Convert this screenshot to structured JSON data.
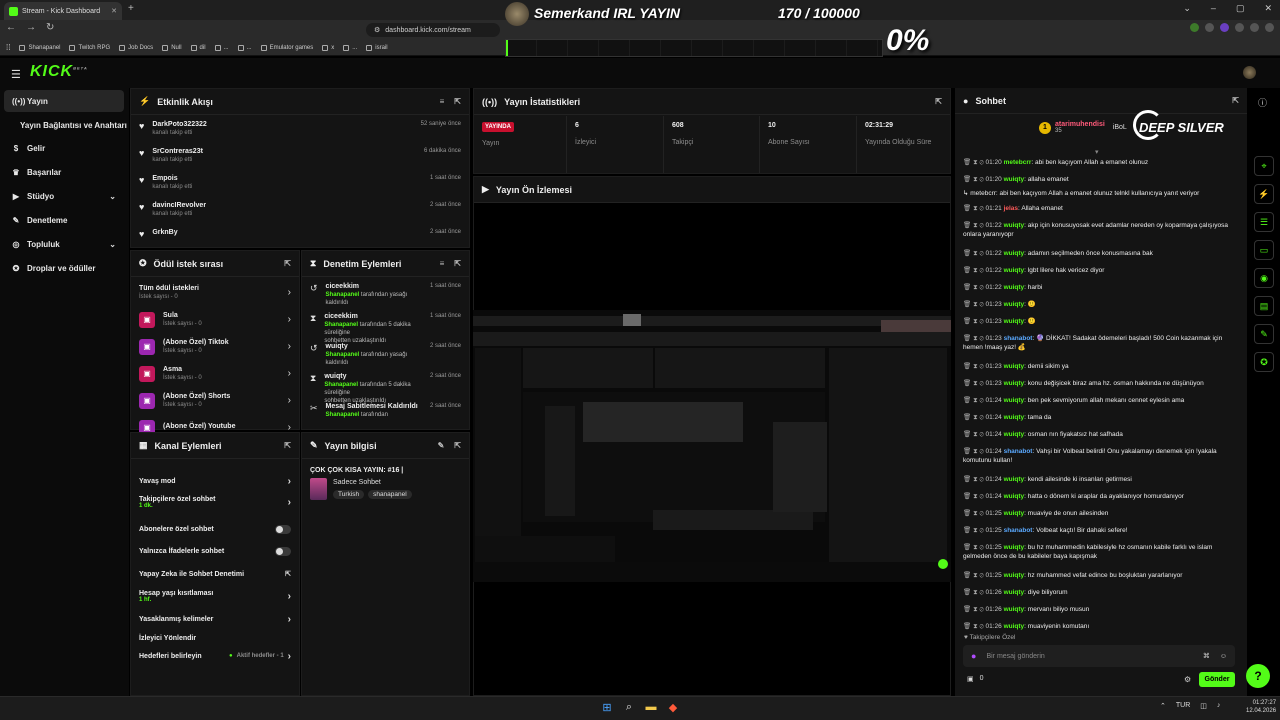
{
  "browser": {
    "tab_title": "Stream - Kick Dashboard",
    "url": "dashboard.kick.com/stream",
    "bookmarks": [
      "Shanapanel",
      "Twitch RPG",
      "Job Docs",
      "Null",
      "dil",
      "...",
      "...",
      "Emulator games",
      "x",
      "...",
      "israil"
    ]
  },
  "overlay": {
    "title": "Semerkand IRL YAYIN",
    "counter": "170 / 100000",
    "percent": "0%",
    "progress": 0.0017
  },
  "sidebar": {
    "items": [
      {
        "label": "Yayın",
        "icon": "broadcast-icon",
        "active": true
      },
      {
        "label": "Yayın Bağlantısı ve Anahtarı",
        "icon": "",
        "active": false
      },
      {
        "label": "Gelir",
        "icon": "money-icon",
        "active": false
      },
      {
        "label": "Başarılar",
        "icon": "trophy-icon",
        "active": false
      },
      {
        "label": "Stüdyo",
        "icon": "video-icon",
        "active": false,
        "expandable": true
      },
      {
        "label": "Denetleme",
        "icon": "wrench-icon",
        "active": false
      },
      {
        "label": "Topluluk",
        "icon": "globe-icon",
        "active": false,
        "expandable": true
      },
      {
        "label": "Droplar ve ödüller",
        "icon": "gift-icon",
        "active": false
      }
    ]
  },
  "activity": {
    "title": "Etkinlik Akışı",
    "events": [
      {
        "name": "DarkPoto322322",
        "action": "kanalı takip etti",
        "time": "52 saniye önce"
      },
      {
        "name": "SrContreras23t",
        "action": "kanalı takip etti",
        "time": "6 dakika önce"
      },
      {
        "name": "Empois",
        "action": "kanalı takip etti",
        "time": "1 saat önce"
      },
      {
        "name": "davincIRevolver",
        "action": "kanalı takip etti",
        "time": "2 saat önce"
      },
      {
        "name": "GrknBy",
        "action": "",
        "time": "2 saat önce"
      }
    ]
  },
  "stats": {
    "title": "Yayın İstatistikleri",
    "live_label": "YAYINDA",
    "live_sub": "Yayın",
    "items": [
      {
        "value": "6",
        "label": "İzleyici"
      },
      {
        "value": "608",
        "label": "Takipçi"
      },
      {
        "value": "10",
        "label": "Abone Sayısı"
      },
      {
        "value": "02:31:29",
        "label": "Yayında Olduğu Süre"
      }
    ]
  },
  "preview": {
    "title": "Yayın Ön İzlemesi"
  },
  "rewards": {
    "title": "Ödül istek sırası",
    "all_label": "Tüm ödül istekleri",
    "all_sub": "İstek sayısı - 0",
    "items": [
      {
        "label": "Sula",
        "sub": "İstek sayısı - 0",
        "color": "#c2185b"
      },
      {
        "label": "(Abone Özel) Tiktok",
        "sub": "İstek sayısı - 0",
        "color": "#9c27b0"
      },
      {
        "label": "Asma",
        "sub": "İstek sayısı - 0",
        "color": "#c2185b"
      },
      {
        "label": "(Abone Özel) Shorts",
        "sub": "İstek sayısı - 0",
        "color": "#9c27b0"
      },
      {
        "label": "(Abone Özel) Youtube",
        "sub": "",
        "color": "#9c27b0"
      }
    ]
  },
  "mod_actions": {
    "title": "Denetim Eylemleri",
    "items": [
      {
        "name": "ciceekkim",
        "actor": "Shanapanel",
        "desc": "tarafından yasağı kaldırıldı",
        "desc2": "",
        "time": "1 saat önce",
        "icon": "undo-icon"
      },
      {
        "name": "ciceekkim",
        "actor": "Shanapanel",
        "desc": "tarafından 5 dakika süreliğine",
        "desc2": "sohbetten uzaklaştırıldı",
        "time": "1 saat önce",
        "icon": "hourglass-icon"
      },
      {
        "name": "wuiqty",
        "actor": "Shanapanel",
        "desc": "tarafından yasağı kaldırıldı",
        "desc2": "",
        "time": "2 saat önce",
        "icon": "undo-icon"
      },
      {
        "name": "wuiqty",
        "actor": "Shanapanel",
        "desc": "tarafından 5 dakika süreliğine",
        "desc2": "sohbetten uzaklaştırıldı",
        "time": "2 saat önce",
        "icon": "hourglass-icon"
      },
      {
        "name": "Mesaj Sabitlemesi Kaldırıldı",
        "actor": "Shanapanel",
        "desc": "tarafından",
        "desc2": "",
        "time": "2 saat önce",
        "icon": "unpin-icon"
      }
    ]
  },
  "channel_actions": {
    "title": "Kanal Eylemleri",
    "items": [
      {
        "label": "Yavaş mod",
        "sub": "",
        "control": "chevron"
      },
      {
        "label": "Takipçilere özel sohbet",
        "sub": "1 dk.",
        "control": "chevron"
      },
      {
        "label": "Abonelere özel sohbet",
        "sub": "",
        "control": "toggle"
      },
      {
        "label": "Yalnızca İfadelerle sohbet",
        "sub": "",
        "control": "toggle"
      },
      {
        "label": "Yapay Zeka ile Sohbet Denetimi",
        "sub": "",
        "control": "external"
      },
      {
        "label": "Hesap yaşı kısıtlaması",
        "sub": "1 hf.",
        "control": "chevron"
      },
      {
        "label": "Yasaklanmış kelimeler",
        "sub": "",
        "control": "chevron"
      },
      {
        "label": "İzleyici Yönlendir",
        "sub": "",
        "control": "none"
      },
      {
        "label": "Hedefleri belirleyin",
        "sub": "",
        "control": "chevron",
        "status": "Aktif hedefler - 1"
      }
    ]
  },
  "stream_info": {
    "title": "Yayın bilgisi",
    "stream_title": "ÇOK ÇOK KISA YAYIN: #16 |",
    "category": "Sadece Sohbet",
    "tags": [
      "Turkish",
      "shanapanel"
    ]
  },
  "chat": {
    "title": "Sohbet",
    "pinned_user": "atarimuhendisi",
    "pinned_count": "35",
    "pinned_extra": "iBoL",
    "sponsor": "DEEP SILVER",
    "messages": [
      {
        "time": "01:20",
        "user": "metebcrr",
        "color": "green",
        "text": "abi ben kaçıyom Allah a emanet olunuz"
      },
      {
        "time": "01:20",
        "user": "wuiqty",
        "color": "green",
        "text": "allaha emanet"
      },
      {
        "reply": "↳ metebcrr: abi ben kaçıyom Allah a emanet olunuz telnkl kullanıcıya yanıt veriyor"
      },
      {
        "time": "01:21",
        "user": "jelas",
        "color": "red",
        "text": "Allaha emanet"
      },
      {
        "time": "01:22",
        "user": "wuiqty",
        "color": "green",
        "text": "akp için konusuyosak evet adamlar nereden oy koparmaya çalışıyosa onlara yaranıyopr"
      },
      {
        "time": "01:22",
        "user": "wuiqty",
        "color": "green",
        "text": "adamın seçilmeden önce konusmasına bak"
      },
      {
        "time": "01:22",
        "user": "wuiqty",
        "color": "green",
        "text": "lgbt lilere hak vericez diyor"
      },
      {
        "time": "01:22",
        "user": "wuiqty",
        "color": "green",
        "text": "harbi"
      },
      {
        "time": "01:23",
        "user": "wuiqty",
        "color": "green",
        "text": "🙂"
      },
      {
        "time": "01:23",
        "user": "wuiqty",
        "color": "green",
        "text": "🙂"
      },
      {
        "time": "01:23",
        "user": "shanabot",
        "color": "blue",
        "text": "🔮 DİKKAT! Sadakat ödemeleri başladı! 500 Coin kazanmak için hemen !maaş yaz! 💰"
      },
      {
        "time": "01:23",
        "user": "wuiqty",
        "color": "green",
        "text": "demii sikim ya"
      },
      {
        "time": "01:23",
        "user": "wuiqty",
        "color": "green",
        "text": "konu değişicek biraz ama hz. osman hakkında ne düşünüyon"
      },
      {
        "time": "01:24",
        "user": "wuiqty",
        "color": "green",
        "text": "ben pek sevmiyorum allah mekanı cennet eylesin ama"
      },
      {
        "time": "01:24",
        "user": "wuiqty",
        "color": "green",
        "text": "tama da"
      },
      {
        "time": "01:24",
        "user": "wuiqty",
        "color": "green",
        "text": "osman nın fiyakatsız hat safhada"
      },
      {
        "time": "01:24",
        "user": "shanabot",
        "color": "blue",
        "text": "Vahşi bir Volbeat belirdi! Onu yakalamayı denemek için !yakala komutunu kullan!"
      },
      {
        "time": "01:24",
        "user": "wuiqty",
        "color": "green",
        "text": "kendi ailesinde ki insanları getirmesi"
      },
      {
        "time": "01:24",
        "user": "wuiqty",
        "color": "green",
        "text": "hatta o dönem ki araplar da ayaklanıyor homurdanıyor"
      },
      {
        "time": "01:25",
        "user": "wuiqty",
        "color": "green",
        "text": "muaviye de onun ailesinden"
      },
      {
        "time": "01:25",
        "user": "shanabot",
        "color": "blue",
        "text": "Volbeat kaçtı! Bir dahaki sefere!"
      },
      {
        "time": "01:25",
        "user": "wuiqty",
        "color": "green",
        "text": "bu hz muhammedin kabilesiyle hz osmanın kabile farklı ve islam gelmeden önce de bu kabileler baya kapışmak"
      },
      {
        "time": "01:25",
        "user": "wuiqty",
        "color": "green",
        "text": "hz muhammed vefat edince bu boşluktan yararlanıyor"
      },
      {
        "time": "01:26",
        "user": "wuiqty",
        "color": "green",
        "text": "diye biliyorum"
      },
      {
        "time": "01:26",
        "user": "wuiqty",
        "color": "green",
        "text": "mervanı biliyo musun"
      },
      {
        "time": "01:26",
        "user": "wuiqty",
        "color": "green",
        "text": "muaviyenin komutanı"
      }
    ],
    "followers_only": "Takipçilere Özel",
    "input_placeholder": "Bir mesaj gönderin",
    "viewer_count": "0",
    "send_label": "Gönder"
  },
  "taskbar": {
    "lang": "TUR",
    "time": "01:27:27",
    "date": "12.04.2026"
  },
  "colors": {
    "accent": "#53fc18",
    "live": "#c8102e",
    "panel": "#141414",
    "bot": "#5aa9ff"
  }
}
